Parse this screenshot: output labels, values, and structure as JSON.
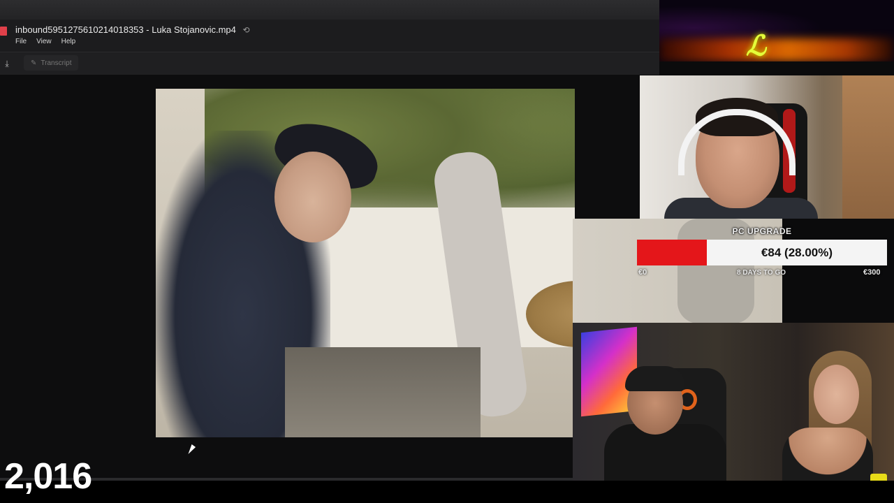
{
  "viewer": {
    "file_title": "inbound5951275610214018353 - Luka Stojanovic.mp4",
    "menu": [
      "File",
      "View",
      "Help"
    ],
    "transcript_label": "Transcript"
  },
  "donation_goal": {
    "label": "PC UPGRADE",
    "amount_text": "€84 (28.00%)",
    "progress_fraction": 0.28,
    "start_label": "€0",
    "days_text": "8 DAYS TO GO",
    "goal_label": "€300",
    "fill_color": "#e4161a"
  },
  "viewer_count": "2,016",
  "icons": {
    "share": "share-icon",
    "download": "download-icon",
    "transcript": "transcript-icon",
    "cursor": "mouse-cursor-icon"
  }
}
